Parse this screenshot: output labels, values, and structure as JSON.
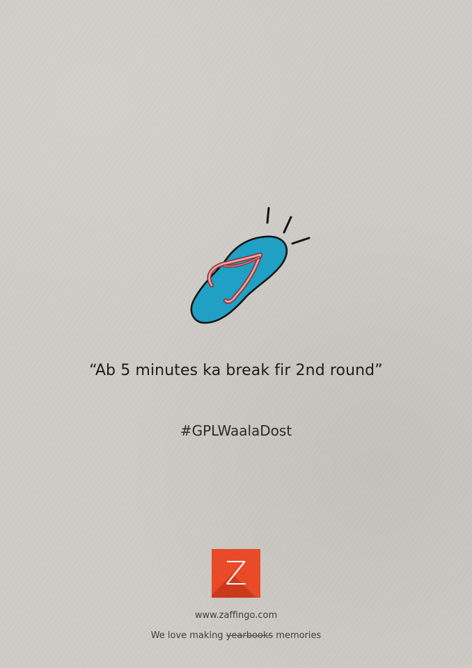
{
  "illustration": {
    "icon": "flip-flop-slipper-icon",
    "sole_color": "#1fa0c4",
    "strap_color": "#e46a6f",
    "outline_color": "#111111"
  },
  "quote": "“Ab 5 minutes ka break fir 2nd round”",
  "hashtag": "#GPLWaalaDost",
  "logo": {
    "letter": "Z",
    "color": "#e94a28"
  },
  "website": "www.zaffingo.com",
  "tagline": {
    "before": "We love making ",
    "struck": "yearbooks",
    "after": " memories"
  }
}
